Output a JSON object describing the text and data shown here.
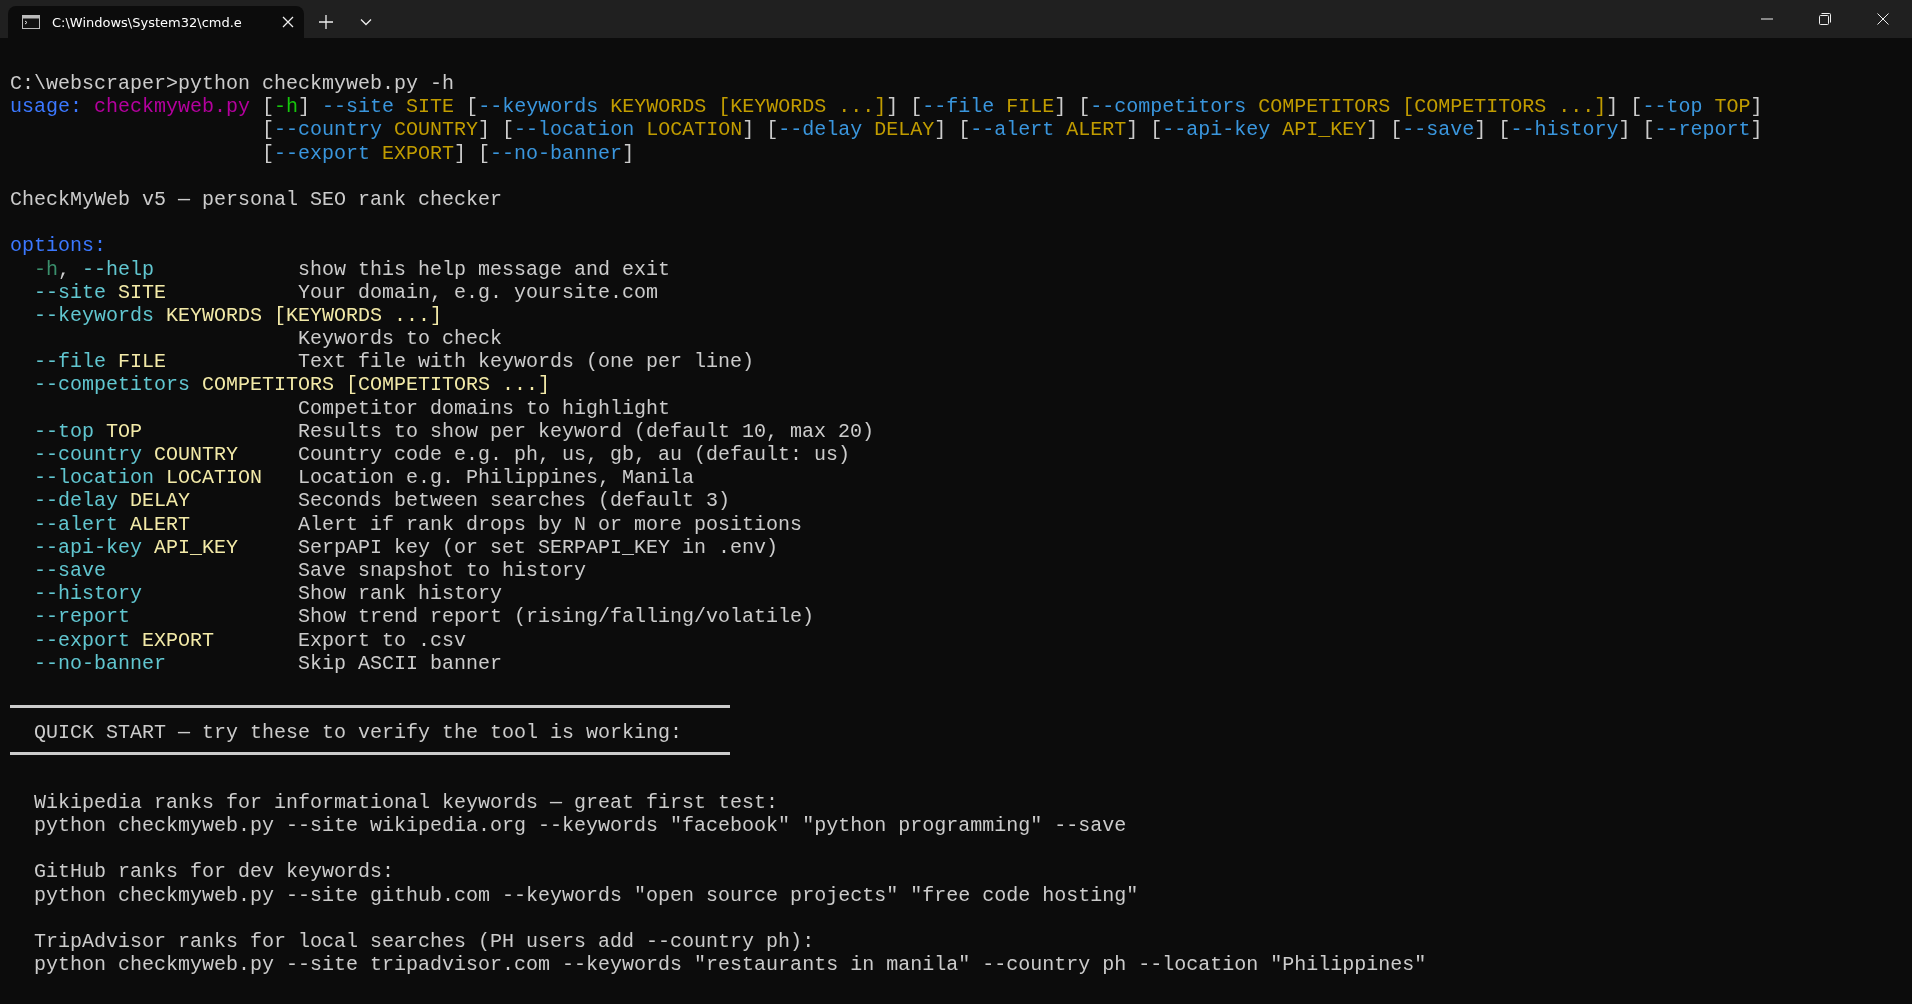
{
  "tab": {
    "title": "C:\\Windows\\System32\\cmd.e",
    "selected": true
  },
  "prompt": "C:\\webscraper>python checkmyweb.py -h",
  "usage": {
    "label": "usage:",
    "prog": "checkmyweb.py",
    "lines": [
      [
        {
          "kind": "bracket",
          "text": "["
        },
        {
          "kind": "short",
          "text": "-h"
        },
        {
          "kind": "bracket",
          "text": "]"
        },
        {
          "kind": "flag",
          "text": " --site"
        },
        {
          "kind": "metavar",
          "text": " SITE"
        },
        {
          "kind": "bracket",
          "text": " ["
        },
        {
          "kind": "flag",
          "text": "--keywords"
        },
        {
          "kind": "metavar",
          "text": " KEYWORDS [KEYWORDS ...]"
        },
        {
          "kind": "bracket",
          "text": "] ["
        },
        {
          "kind": "flag",
          "text": "--file"
        },
        {
          "kind": "metavar",
          "text": " FILE"
        },
        {
          "kind": "bracket",
          "text": "] ["
        },
        {
          "kind": "flag",
          "text": "--competitors"
        },
        {
          "kind": "metavar",
          "text": " COMPETITORS [COMPETITORS ...]"
        },
        {
          "kind": "bracket",
          "text": "] ["
        },
        {
          "kind": "flag",
          "text": "--top"
        },
        {
          "kind": "metavar",
          "text": " TOP"
        },
        {
          "kind": "bracket",
          "text": "]"
        }
      ],
      [
        {
          "kind": "bracket",
          "text": "["
        },
        {
          "kind": "flag",
          "text": "--country"
        },
        {
          "kind": "metavar",
          "text": " COUNTRY"
        },
        {
          "kind": "bracket",
          "text": "] ["
        },
        {
          "kind": "flag",
          "text": "--location"
        },
        {
          "kind": "metavar",
          "text": " LOCATION"
        },
        {
          "kind": "bracket",
          "text": "] ["
        },
        {
          "kind": "flag",
          "text": "--delay"
        },
        {
          "kind": "metavar",
          "text": " DELAY"
        },
        {
          "kind": "bracket",
          "text": "] ["
        },
        {
          "kind": "flag",
          "text": "--alert"
        },
        {
          "kind": "metavar",
          "text": " ALERT"
        },
        {
          "kind": "bracket",
          "text": "] ["
        },
        {
          "kind": "flag",
          "text": "--api-key"
        },
        {
          "kind": "metavar",
          "text": " API_KEY"
        },
        {
          "kind": "bracket",
          "text": "] ["
        },
        {
          "kind": "flag",
          "text": "--save"
        },
        {
          "kind": "bracket",
          "text": "] ["
        },
        {
          "kind": "flag",
          "text": "--history"
        },
        {
          "kind": "bracket",
          "text": "] ["
        },
        {
          "kind": "flag",
          "text": "--report"
        },
        {
          "kind": "bracket",
          "text": "]"
        }
      ],
      [
        {
          "kind": "bracket",
          "text": "["
        },
        {
          "kind": "flag",
          "text": "--export"
        },
        {
          "kind": "metavar",
          "text": " EXPORT"
        },
        {
          "kind": "bracket",
          "text": "] ["
        },
        {
          "kind": "flag",
          "text": "--no-banner"
        },
        {
          "kind": "bracket",
          "text": "]"
        }
      ]
    ]
  },
  "description": "CheckMyWeb v5 — personal SEO rank checker",
  "options": {
    "heading": "options:",
    "rows": [
      {
        "parts": [
          {
            "kind": "short",
            "text": "-h"
          },
          {
            "kind": "plain",
            "text": ", "
          },
          {
            "kind": "flag",
            "text": "--help"
          }
        ],
        "help": "show this help message and exit"
      },
      {
        "parts": [
          {
            "kind": "flag",
            "text": "--site"
          },
          {
            "kind": "metavar",
            "text": " SITE"
          }
        ],
        "help": "Your domain, e.g. yoursite.com"
      },
      {
        "parts": [
          {
            "kind": "flag",
            "text": "--keywords"
          },
          {
            "kind": "metavar",
            "text": " KEYWORDS [KEYWORDS ...]"
          }
        ]
      },
      {
        "help": "Keywords to check"
      },
      {
        "parts": [
          {
            "kind": "flag",
            "text": "--file"
          },
          {
            "kind": "metavar",
            "text": " FILE"
          }
        ],
        "help": "Text file with keywords (one per line)"
      },
      {
        "parts": [
          {
            "kind": "flag",
            "text": "--competitors"
          },
          {
            "kind": "metavar",
            "text": " COMPETITORS [COMPETITORS ...]"
          }
        ]
      },
      {
        "help": "Competitor domains to highlight"
      },
      {
        "parts": [
          {
            "kind": "flag",
            "text": "--top"
          },
          {
            "kind": "metavar",
            "text": " TOP"
          }
        ],
        "help": "Results to show per keyword (default 10, max 20)"
      },
      {
        "parts": [
          {
            "kind": "flag",
            "text": "--country"
          },
          {
            "kind": "metavar",
            "text": " COUNTRY"
          }
        ],
        "help": "Country code e.g. ph, us, gb, au (default: us)"
      },
      {
        "parts": [
          {
            "kind": "flag",
            "text": "--location"
          },
          {
            "kind": "metavar",
            "text": " LOCATION"
          }
        ],
        "help": "Location e.g. Philippines, Manila"
      },
      {
        "parts": [
          {
            "kind": "flag",
            "text": "--delay"
          },
          {
            "kind": "metavar",
            "text": " DELAY"
          }
        ],
        "help": "Seconds between searches (default 3)"
      },
      {
        "parts": [
          {
            "kind": "flag",
            "text": "--alert"
          },
          {
            "kind": "metavar",
            "text": " ALERT"
          }
        ],
        "help": "Alert if rank drops by N or more positions"
      },
      {
        "parts": [
          {
            "kind": "flag",
            "text": "--api-key"
          },
          {
            "kind": "metavar",
            "text": " API_KEY"
          }
        ],
        "help": "SerpAPI key (or set SERPAPI_KEY in .env)"
      },
      {
        "parts": [
          {
            "kind": "flag",
            "text": "--save"
          }
        ],
        "help": "Save snapshot to history"
      },
      {
        "parts": [
          {
            "kind": "flag",
            "text": "--history"
          }
        ],
        "help": "Show rank history"
      },
      {
        "parts": [
          {
            "kind": "flag",
            "text": "--report"
          }
        ],
        "help": "Show trend report (rising/falling/volatile)"
      },
      {
        "parts": [
          {
            "kind": "flag",
            "text": "--export"
          },
          {
            "kind": "metavar",
            "text": " EXPORT"
          }
        ],
        "help": "Export to .csv"
      },
      {
        "parts": [
          {
            "kind": "flag",
            "text": "--no-banner"
          }
        ],
        "help": "Skip ASCII banner"
      }
    ]
  },
  "quick_start": {
    "title": "QUICK START — try these to verify the tool is working:",
    "examples": [
      {
        "description": "Wikipedia ranks for informational keywords — great first test:",
        "command": "python checkmyweb.py --site wikipedia.org --keywords \"facebook\" \"python programming\" --save"
      },
      {
        "description": "GitHub ranks for dev keywords:",
        "command": "python checkmyweb.py --site github.com --keywords \"open source projects\" \"free code hosting\""
      },
      {
        "description": "TripAdvisor ranks for local searches (PH users add --country ph):",
        "command": "python checkmyweb.py --site tripadvisor.com --keywords \"restaurants in manila\" --country ph --location \"Philippines\""
      }
    ]
  }
}
